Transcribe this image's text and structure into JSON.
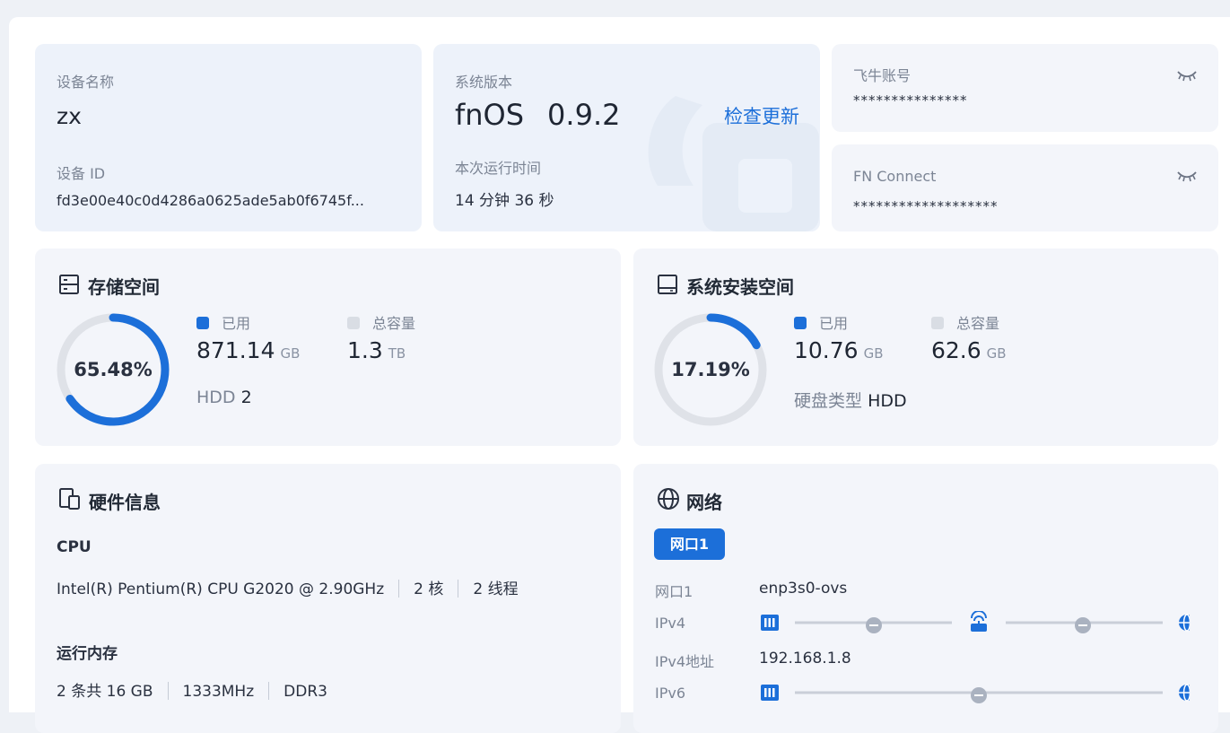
{
  "device": {
    "name_label": "设备名称",
    "name": "zx",
    "id_label": "设备 ID",
    "id": "fd3e00e40c0d4286a0625ade5ab0f6745f..."
  },
  "system": {
    "version_label": "系统版本",
    "os": "fnOS",
    "version": "0.9.2",
    "check_update": "检查更新",
    "uptime_label": "本次运行时间",
    "uptime": "14 分钟 36 秒"
  },
  "account": {
    "label": "飞牛账号",
    "masked": "***************",
    "icon": "eye-closed-icon"
  },
  "fnconnect": {
    "label": "FN Connect",
    "masked": "*******************",
    "icon": "eye-closed-icon"
  },
  "storage": {
    "title": "存储空间",
    "icon": "storage-icon",
    "percent_text": "65.48%",
    "percent": 65.48,
    "used_label": "已用",
    "used_value": "871.14",
    "used_unit": "GB",
    "total_label": "总容量",
    "total_value": "1.3",
    "total_unit": "TB",
    "disk_type": "HDD",
    "disk_count": "2"
  },
  "sys_storage": {
    "title": "系统安装空间",
    "icon": "drive-icon",
    "percent_text": "17.19%",
    "percent": 17.19,
    "used_label": "已用",
    "used_value": "10.76",
    "used_unit": "GB",
    "total_label": "总容量",
    "total_value": "62.6",
    "total_unit": "GB",
    "disk_type_label": "硬盘类型",
    "disk_type": "HDD"
  },
  "hardware": {
    "title": "硬件信息",
    "icon": "devices-icon",
    "cpu_label": "CPU",
    "cpu_model": "Intel(R) Pentium(R) CPU G2020 @ 2.90GHz",
    "cpu_cores": "2 核",
    "cpu_threads": "2 线程",
    "ram_label": "运行内存",
    "ram_total": "2 条共 16 GB",
    "ram_speed": "1333MHz",
    "ram_type": "DDR3"
  },
  "network": {
    "title": "网络",
    "icon": "globe-icon",
    "tab": "网口1",
    "rows": [
      {
        "label": "网口1",
        "value": "enp3s0-ovs"
      },
      {
        "label": "IPv4",
        "value": ""
      },
      {
        "label": "IPv4地址",
        "value": "192.168.1.8"
      },
      {
        "label": "IPv6",
        "value": ""
      }
    ]
  },
  "colors": {
    "accent": "#1c6fd9",
    "ring_track": "#dfe2e8",
    "legend_total": "#d9dde4",
    "card_bg": "#f3f5fa"
  }
}
